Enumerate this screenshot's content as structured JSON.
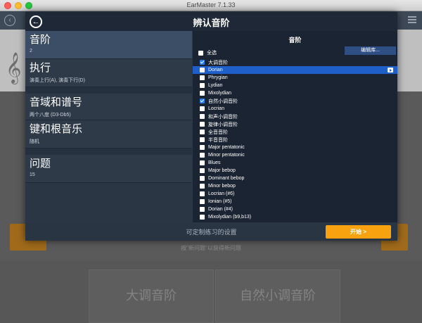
{
  "window": {
    "title": "EarMaster 7.1.33"
  },
  "background": {
    "hint": "按\"新问题\"以获得新问题",
    "cards": [
      "大调音阶",
      "自然小调音阶"
    ]
  },
  "modal": {
    "title": "辨认音阶",
    "settings": [
      {
        "label": "音阶",
        "value": "2"
      },
      {
        "label": "执行",
        "value": "演奏上行(A), 演奏下行(D)"
      },
      {
        "label": "音域和谱号",
        "value": "两个八度 (D3-Db5)"
      },
      {
        "label": "键和根音乐",
        "value": "随机"
      },
      {
        "label": "问题",
        "value": "15"
      }
    ],
    "scales_panel": {
      "title": "音阶",
      "select_all": "全选",
      "edit_library": "编辑库...",
      "items": [
        {
          "label": "大调音阶",
          "checked": true
        },
        {
          "label": "Dorian",
          "checked": false,
          "selected": true
        },
        {
          "label": "Phrygian",
          "checked": false
        },
        {
          "label": "Lydian",
          "checked": false
        },
        {
          "label": "Mixolydian",
          "checked": false
        },
        {
          "label": "自然小调音阶",
          "checked": true
        },
        {
          "label": "Locrian",
          "checked": false
        },
        {
          "label": "和声小调音阶",
          "checked": false
        },
        {
          "label": "旋律小调音阶",
          "checked": false
        },
        {
          "label": "全音音阶",
          "checked": false
        },
        {
          "label": "半音音阶",
          "checked": false
        },
        {
          "label": "Major pentatonic",
          "checked": false
        },
        {
          "label": "Minor pentatonic",
          "checked": false
        },
        {
          "label": "Blues",
          "checked": false
        },
        {
          "label": "Major bebop",
          "checked": false
        },
        {
          "label": "Dominant bebop",
          "checked": false
        },
        {
          "label": "Minor bebop",
          "checked": false
        },
        {
          "label": "Locrian (#6)",
          "checked": false
        },
        {
          "label": "Ionian (#5)",
          "checked": false
        },
        {
          "label": "Dorian (#4)",
          "checked": false
        },
        {
          "label": "Mixolydian (b9,b13)",
          "checked": false
        }
      ]
    },
    "footer": {
      "caption": "可定制练习的设置",
      "start_label": "开始 >"
    }
  }
}
